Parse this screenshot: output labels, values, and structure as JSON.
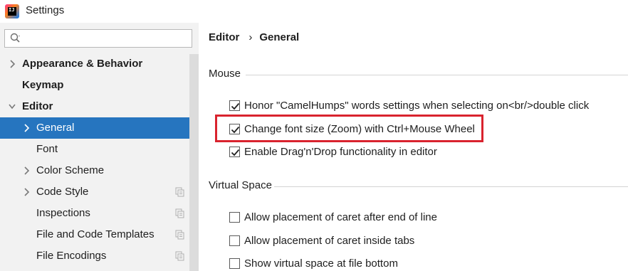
{
  "window": {
    "title": "Settings"
  },
  "sidebar": {
    "search": {
      "placeholder": "",
      "value": ""
    },
    "items": [
      {
        "label": "Appearance & Behavior",
        "bold": true,
        "chevron": "right",
        "level": 0
      },
      {
        "label": "Keymap",
        "bold": true,
        "chevron": "none",
        "level": 0
      },
      {
        "label": "Editor",
        "bold": true,
        "chevron": "down",
        "level": 0
      },
      {
        "label": "General",
        "bold": false,
        "chevron": "right",
        "level": 1,
        "selected": true
      },
      {
        "label": "Font",
        "bold": false,
        "chevron": "none",
        "level": 1
      },
      {
        "label": "Color Scheme",
        "bold": false,
        "chevron": "right",
        "level": 1
      },
      {
        "label": "Code Style",
        "bold": false,
        "chevron": "right",
        "level": 1,
        "project_icon": true
      },
      {
        "label": "Inspections",
        "bold": false,
        "chevron": "none",
        "level": 1,
        "project_icon": true
      },
      {
        "label": "File and Code Templates",
        "bold": false,
        "chevron": "none",
        "level": 1,
        "project_icon": true
      },
      {
        "label": "File Encodings",
        "bold": false,
        "chevron": "none",
        "level": 1,
        "project_icon": true
      }
    ]
  },
  "breadcrumb": {
    "parent": "Editor",
    "separator": "›",
    "current": "General"
  },
  "groups": {
    "mouse": {
      "title": "Mouse",
      "options": [
        {
          "label": "Honor \"CamelHumps\" words settings when selecting on<br/>double click",
          "checked": true
        },
        {
          "label": "Change font size (Zoom) with Ctrl+Mouse Wheel",
          "checked": true,
          "highlighted": true
        },
        {
          "label": "Enable Drag'n'Drop functionality in editor",
          "checked": true
        }
      ]
    },
    "virtual_space": {
      "title": "Virtual Space",
      "options": [
        {
          "label": "Allow placement of caret after end of line",
          "checked": false
        },
        {
          "label": "Allow placement of caret inside tabs",
          "checked": false
        },
        {
          "label": "Show virtual space at file bottom",
          "checked": false
        }
      ]
    }
  },
  "colors": {
    "selection": "#2675bf",
    "sidebar_bg": "#f2f2f2",
    "highlight_border": "#d9232e"
  }
}
